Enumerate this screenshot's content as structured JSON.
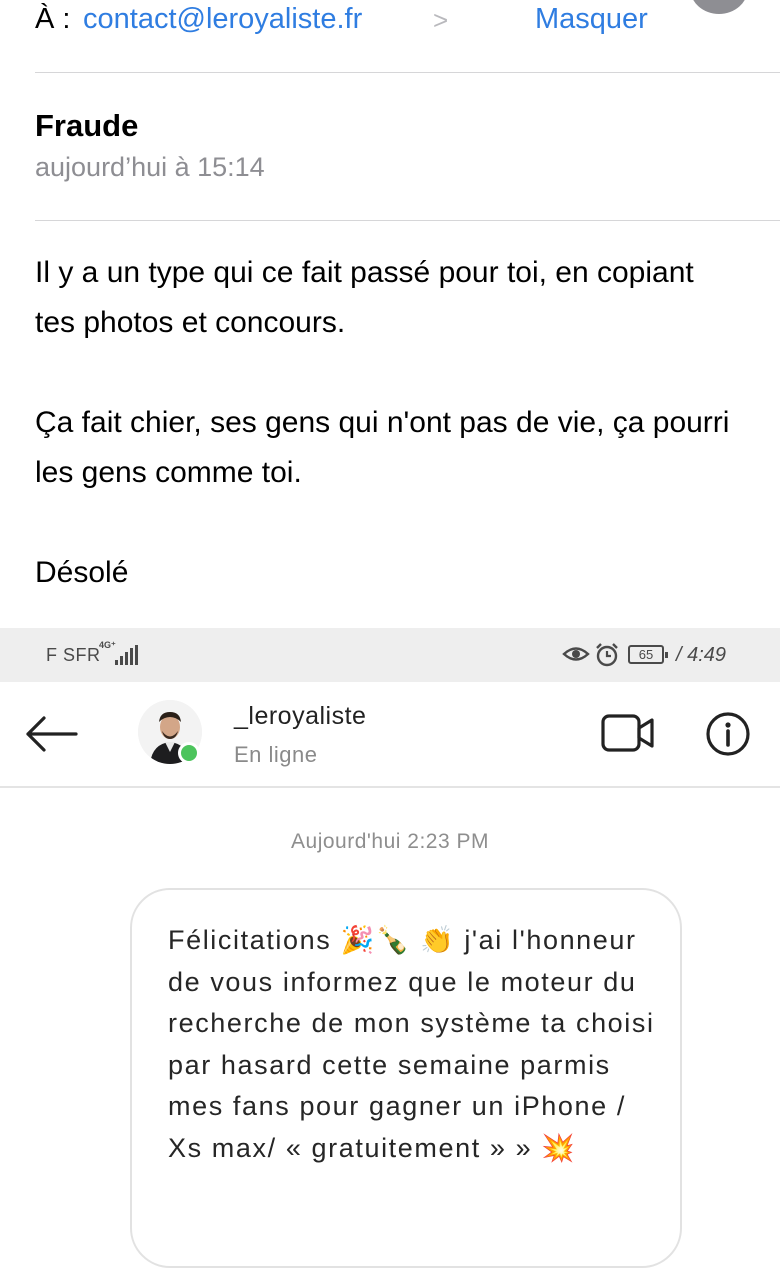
{
  "email": {
    "to_label": "À :",
    "to_address": "contact@leroyaliste.fr",
    "hide_label": "Masquer",
    "subject": "Fraude",
    "date": "aujourd’hui à 15:14",
    "body": [
      "Il y a un type qui ce fait passé pour toi, en copiant tes photos et concours.",
      "Ça fait chier, ses gens qui n'ont pas de vie, ça pourri les gens comme toi.",
      "Désolé"
    ]
  },
  "status_bar": {
    "carrier": "F SFR",
    "network": "4G⁺",
    "battery": "65",
    "time": "/ 4:49",
    "icons": [
      "signal-icon",
      "eye-icon",
      "alarm-icon",
      "battery-icon"
    ]
  },
  "chat": {
    "username": "_leroyaliste",
    "presence": "En ligne",
    "date_label": "Aujourd'hui 2:23 PM",
    "message": "Félicitations 🎉🍾 👏 j'ai l'honneur de vous informez que le moteur du recherche de mon système ta choisi par hasard cette semaine parmis mes fans pour gagner un iPhone / Xs max/ « gratuitement » » 💥",
    "icons": [
      "back-arrow-icon",
      "video-call-icon",
      "info-icon"
    ],
    "online_color": "#4cc45c"
  },
  "colors": {
    "link_blue": "#2f7de1",
    "secondary_gray": "#8e8e93"
  }
}
